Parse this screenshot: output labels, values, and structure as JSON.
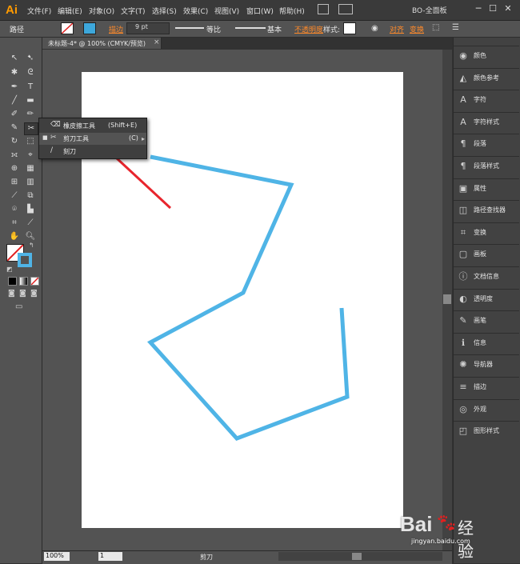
{
  "app": {
    "logo": "Ai"
  },
  "menu": [
    "文件(F)",
    "编辑(E)",
    "对象(O)",
    "文字(T)",
    "选择(S)",
    "效果(C)",
    "视图(V)",
    "窗口(W)",
    "帮助(H)"
  ],
  "workspace": "BO-全面板",
  "window_controls": {
    "min": "─",
    "max": "☐",
    "close": "✕"
  },
  "control_bar": {
    "object_label": "路径",
    "stroke_label": "描边",
    "stroke_weight": "9 pt",
    "profile_label": "等比",
    "brush_label": "基本",
    "opacity_label": "不透明度",
    "style_label": "样式:",
    "align_label": "对齐",
    "transform_label": "变换"
  },
  "document_tab": {
    "title": "未标题-4* @ 100% (CMYK/预览)",
    "close": "×"
  },
  "flyout": {
    "items": [
      {
        "icon": "eraser-icon",
        "glyph": "⌫",
        "label": "橡皮擦工具",
        "shortcut": "(Shift+E)",
        "selected": false
      },
      {
        "icon": "scissors-icon",
        "glyph": "✂",
        "label": "剪刀工具",
        "shortcut": "(C)",
        "selected": true
      },
      {
        "icon": "knife-icon",
        "glyph": "∕",
        "label": "刻刀",
        "shortcut": "",
        "selected": false
      }
    ],
    "tearoff": "▸"
  },
  "status_bar": {
    "zoom": "100%",
    "page": "1",
    "tool_name": "剪刀"
  },
  "right_panel": [
    {
      "icon": "color-icon",
      "glyph": "◉",
      "label": "颜色"
    },
    {
      "icon": "color-guide-icon",
      "glyph": "◭",
      "label": "颜色参考"
    },
    {
      "icon": "character-icon",
      "glyph": "A",
      "label": "字符"
    },
    {
      "icon": "character-style-icon",
      "glyph": "A",
      "label": "字符样式"
    },
    {
      "icon": "paragraph-icon",
      "glyph": "¶",
      "label": "段落"
    },
    {
      "icon": "paragraph-style-icon",
      "glyph": "¶",
      "label": "段落样式"
    },
    {
      "icon": "attributes-icon",
      "glyph": "▣",
      "label": "属性"
    },
    {
      "icon": "pathfinder-icon",
      "glyph": "◫",
      "label": "路径查找器"
    },
    {
      "icon": "transform-icon",
      "glyph": "⌗",
      "label": "变换"
    },
    {
      "icon": "artboard-icon",
      "glyph": "▢",
      "label": "画板"
    },
    {
      "icon": "document-info-icon",
      "glyph": "ⓘ",
      "label": "文档信息"
    },
    {
      "icon": "transparency-icon",
      "glyph": "◐",
      "label": "透明度"
    },
    {
      "icon": "brushes-icon",
      "glyph": "✎",
      "label": "画笔"
    },
    {
      "icon": "info-icon",
      "glyph": "ℹ",
      "label": "信息"
    },
    {
      "icon": "navigator-icon",
      "glyph": "✺",
      "label": "导航器"
    },
    {
      "icon": "stroke-icon",
      "glyph": "≡",
      "label": "描边"
    },
    {
      "icon": "appearance-icon",
      "glyph": "◎",
      "label": "外观"
    },
    {
      "icon": "graphic-styles-icon",
      "glyph": "◰",
      "label": "图形样式"
    }
  ],
  "colors": {
    "path_stroke": "#4fb4e6",
    "arrow": "#e8252d",
    "accent_orange": "#ff8a2a"
  },
  "watermark": {
    "brand": "Bai",
    "brand2": "经验",
    "url": "jingyan.baidu.com"
  }
}
